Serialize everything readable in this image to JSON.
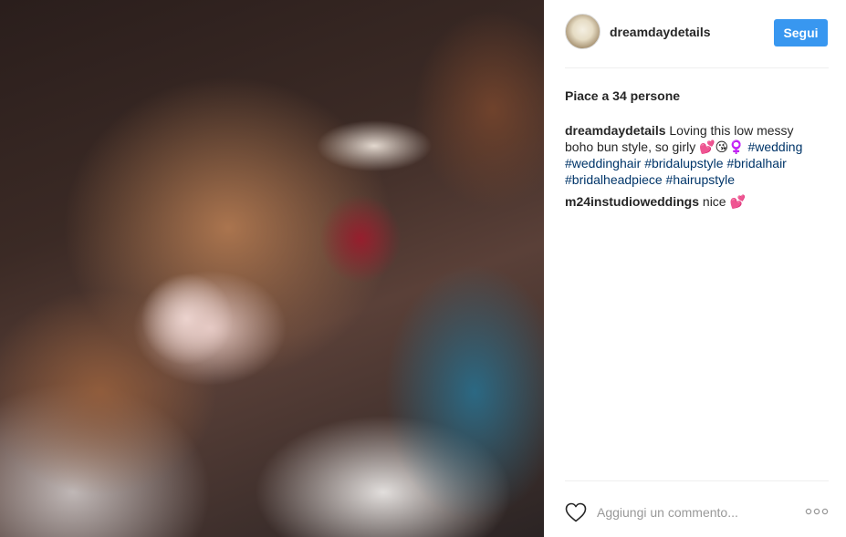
{
  "post": {
    "photo_description_icon": "photo"
  },
  "header": {
    "username": "dreamdaydetails",
    "follow_label": "Segui",
    "avatar_icon": "avatar"
  },
  "likes": {
    "text": "Piace a 34 persone"
  },
  "comments": [
    {
      "user": "dreamdaydetails",
      "text": "Loving this low messy boho bun style, so girly 💕😘♀️",
      "tags": [
        "#wedding",
        "#weddinghair",
        "#bridalupstyle",
        "#bridalhair",
        "#bridalheadpiece",
        "#hairupstyle"
      ]
    },
    {
      "user": "m24instudioweddings",
      "text": "nice 💕",
      "tags": []
    }
  ],
  "actions": {
    "like_icon": "heart-icon",
    "comment_placeholder": "Aggiungi un commento...",
    "more_icon": "more-options-icon"
  },
  "colors": {
    "follow_button": "#3897f0",
    "hashtag": "#003569",
    "text": "#262626",
    "placeholder": "#999999"
  }
}
